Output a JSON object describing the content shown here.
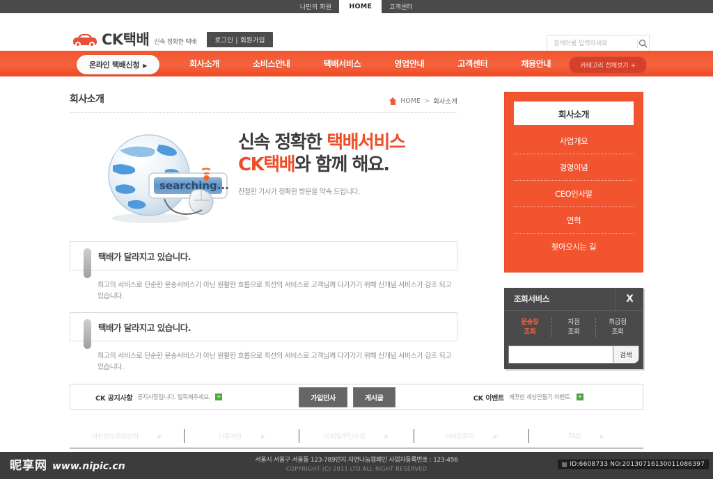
{
  "topbar": {
    "items": [
      {
        "label": "나만의 화원",
        "active": false
      },
      {
        "label": "HOME",
        "active": true
      },
      {
        "label": "고객센터",
        "active": false
      }
    ]
  },
  "header": {
    "logo_icon": "car-icon",
    "logo_text": "CK택배",
    "logo_tagline": "신속 정확한 택배",
    "auth_button": "로그인  |  회원가입",
    "search": {
      "placeholder": "검색어를 입력하세요",
      "value": "",
      "icon": "search-icon"
    }
  },
  "nav": {
    "primary_pill": "온라인 택배신청",
    "primary_pill_caret": "▶",
    "items": [
      "회사소개",
      "소비스안내",
      "택배서비스",
      "영업안내",
      "고객센터",
      "채용안내"
    ],
    "category_button": "카테고리 전체보기 +",
    "accent_color": "#f2552f"
  },
  "main": {
    "page_title": "회사소개",
    "breadcrumb": {
      "home_icon": "home-icon",
      "home": "HOME",
      "separator": ">",
      "current": "회사소개"
    },
    "hero": {
      "image_label": "searching...",
      "line1_plain": "신속 정확한 ",
      "line1_accent": "택배서비스",
      "line2_accent": "CK택배",
      "line2_plain": "와 함께 해요.",
      "subtitle": "친절한 기사가 정확한 방문을 약속 드립니다."
    },
    "blocks": [
      {
        "title": "택배가 달라지고 있습니다.",
        "body": "최고의 서비스로 단순한 운송서비스가 아닌 원활한 흐름으로 최선의 서비스로 고객님께 다가가기 위해 신개념 서비스가 강조 되고 있습니다."
      },
      {
        "title": "택배가 달라지고 있습니다.",
        "body": "최고의 서비스로 단순한 운송서비스가 아닌 원활한 흐름으로 최선의 서비스로 고객님께 다가가기 위해 신개념 서비스가 강조 되고 있습니다."
      }
    ]
  },
  "sidebar": {
    "menu_title": "회사소개",
    "menu_items": [
      "사업개요",
      "경영이념",
      "CEO인사말",
      "연혁",
      "찾아오시는 길"
    ],
    "widget": {
      "title": "조회서비스",
      "close_label": "X",
      "tabs": [
        {
          "line1": "운송장",
          "line2": "조회",
          "active": true
        },
        {
          "line1": "지점",
          "line2": "조회",
          "active": false
        },
        {
          "line1": "취급점",
          "line2": "조회",
          "active": false
        }
      ],
      "input_value": "",
      "input_placeholder": "",
      "submit_label": "검색"
    }
  },
  "notice": {
    "left": {
      "label": "CK 공지사항",
      "text": "공지사항입니다. 필독해주세요.",
      "badge": "+"
    },
    "buttons": [
      "가입인사",
      "게시글"
    ],
    "right": {
      "label": "CK 이벤트",
      "text": "깨끗한 세상만들기 이벤트.",
      "badge": "+"
    }
  },
  "footer": {
    "links": [
      {
        "label": "개인정보취급방침",
        "arrow": "▶"
      },
      {
        "label": "이용약관",
        "arrow": "▶"
      },
      {
        "label": "이메일무단수집",
        "arrow": "▶"
      },
      {
        "label": "이메일문의",
        "arrow": "▶"
      },
      {
        "label": "FAQ",
        "arrow": "▶"
      }
    ],
    "address": "서울시 서울구 서울동 123-789번지 자연나눔캠페인 사업자등록번호 : 123-456",
    "copyright": "COPYRIGHT (C) 2011 LTD ALL RIGHT RESERVED"
  },
  "watermark": {
    "brand_cn": "昵享网",
    "url": "www.nipic.cn"
  },
  "id_badge": {
    "text": "ID:6608733 NO:20130716130011086397"
  }
}
